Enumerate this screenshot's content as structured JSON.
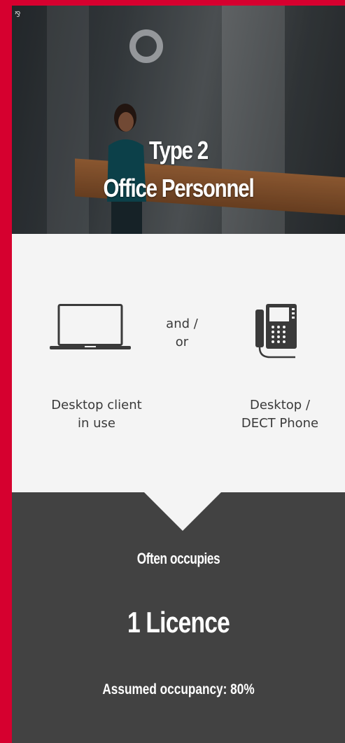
{
  "hero": {
    "title_line1": "Type 2",
    "title_line2": "Office Personnel"
  },
  "devices": {
    "connector": "and / or",
    "connector_line1": "and /",
    "connector_line2": "or",
    "left": {
      "icon": "laptop-icon",
      "label_line1": "Desktop client",
      "label_line2": "in use"
    },
    "right": {
      "icon": "desk-phone-icon",
      "label_line1": "Desktop /",
      "label_line2": "DECT Phone"
    }
  },
  "summary": {
    "occupies_label": "Often occupies",
    "licence_count": "1 Licence",
    "occupancy_label": "Assumed occupancy:",
    "occupancy_value": "80%"
  },
  "colors": {
    "frame": "#d6002f",
    "panel": "#f4f4f4",
    "dark": "#424242",
    "text": "#3a3a3a"
  }
}
